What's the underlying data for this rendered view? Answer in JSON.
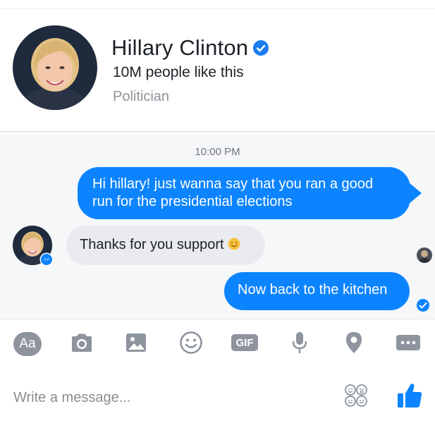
{
  "profile": {
    "name": "Hillary Clinton",
    "likes": "10M people like this",
    "category": "Politician",
    "verified_icon": "verified-badge-icon"
  },
  "thread": {
    "timestamp": "10:00 PM",
    "messages": [
      {
        "direction": "outgoing",
        "text": "Hi hillary! just wanna say that you ran a good run for the presidential elections"
      },
      {
        "direction": "incoming",
        "text": "Thanks for you support"
      },
      {
        "direction": "outgoing",
        "text": "Now back to the kitchen"
      }
    ]
  },
  "composer": {
    "aa_label": "Aa",
    "gif_label": "GIF",
    "placeholder": "Write a message..."
  },
  "colors": {
    "accent": "#0c84ff",
    "incoming_bubble": "#e9ebee",
    "icon_gray": "#8d949e",
    "thread_bg": "#f6f7f9"
  }
}
